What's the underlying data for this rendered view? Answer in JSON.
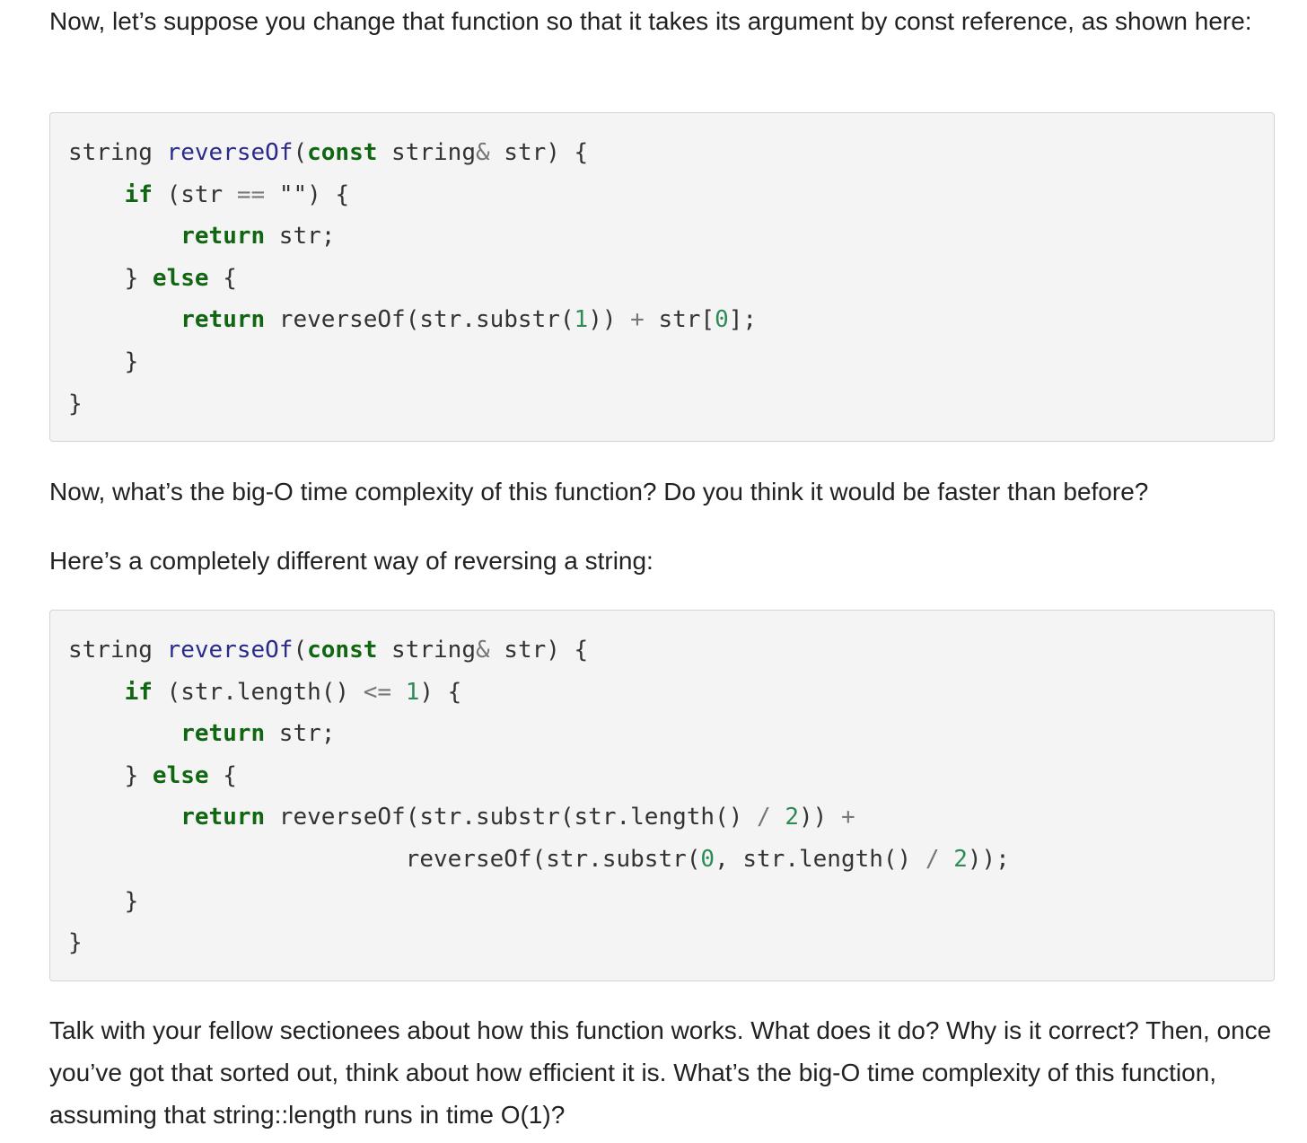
{
  "paragraphs": {
    "intro": "Now, let’s suppose you change that function so that it takes its argument by const reference, as shown here:",
    "question_bigo": "Now, what’s the big-O time complexity of this function? Do you think it would be faster than before?",
    "different_way": "Here’s a completely different way of reversing a string:",
    "discussion": "Talk with your fellow sectionees about how this function works. What does it do? Why is it correct? Then, once you’ve got that sorted out, think about how efficient it is. What’s the big-O time complexity of this function, assuming that string::length runs in time O(1)?"
  },
  "code_block_1": {
    "lines": [
      [
        {
          "t": "string ",
          "c": ""
        },
        {
          "t": "reverseOf",
          "c": "fn"
        },
        {
          "t": "(",
          "c": ""
        },
        {
          "t": "const",
          "c": "kw"
        },
        {
          "t": " string",
          "c": ""
        },
        {
          "t": "&",
          "c": "op"
        },
        {
          "t": " str) {",
          "c": ""
        }
      ],
      [
        {
          "t": "    ",
          "c": ""
        },
        {
          "t": "if",
          "c": "kw"
        },
        {
          "t": " (str ",
          "c": ""
        },
        {
          "t": "==",
          "c": "op"
        },
        {
          "t": " \"\") {",
          "c": ""
        }
      ],
      [
        {
          "t": "        ",
          "c": ""
        },
        {
          "t": "return",
          "c": "kw"
        },
        {
          "t": " str;",
          "c": ""
        }
      ],
      [
        {
          "t": "    } ",
          "c": ""
        },
        {
          "t": "else",
          "c": "kw"
        },
        {
          "t": " {",
          "c": ""
        }
      ],
      [
        {
          "t": "        ",
          "c": ""
        },
        {
          "t": "return",
          "c": "kw"
        },
        {
          "t": " reverseOf(str.substr(",
          "c": ""
        },
        {
          "t": "1",
          "c": "num"
        },
        {
          "t": ")) ",
          "c": ""
        },
        {
          "t": "+",
          "c": "op"
        },
        {
          "t": " str[",
          "c": ""
        },
        {
          "t": "0",
          "c": "num"
        },
        {
          "t": "];",
          "c": ""
        }
      ],
      [
        {
          "t": "    }",
          "c": ""
        }
      ],
      [
        {
          "t": "}",
          "c": ""
        }
      ]
    ]
  },
  "code_block_2": {
    "lines": [
      [
        {
          "t": "string ",
          "c": ""
        },
        {
          "t": "reverseOf",
          "c": "fn"
        },
        {
          "t": "(",
          "c": ""
        },
        {
          "t": "const",
          "c": "kw"
        },
        {
          "t": " string",
          "c": ""
        },
        {
          "t": "&",
          "c": "op"
        },
        {
          "t": " str) {",
          "c": ""
        }
      ],
      [
        {
          "t": "    ",
          "c": ""
        },
        {
          "t": "if",
          "c": "kw"
        },
        {
          "t": " (str.length() ",
          "c": ""
        },
        {
          "t": "<=",
          "c": "op"
        },
        {
          "t": " ",
          "c": ""
        },
        {
          "t": "1",
          "c": "num"
        },
        {
          "t": ") {",
          "c": ""
        }
      ],
      [
        {
          "t": "        ",
          "c": ""
        },
        {
          "t": "return",
          "c": "kw"
        },
        {
          "t": " str;",
          "c": ""
        }
      ],
      [
        {
          "t": "    } ",
          "c": ""
        },
        {
          "t": "else",
          "c": "kw"
        },
        {
          "t": " {",
          "c": ""
        }
      ],
      [
        {
          "t": "        ",
          "c": ""
        },
        {
          "t": "return",
          "c": "kw"
        },
        {
          "t": " reverseOf(str.substr(str.length() ",
          "c": ""
        },
        {
          "t": "/",
          "c": "op"
        },
        {
          "t": " ",
          "c": ""
        },
        {
          "t": "2",
          "c": "num"
        },
        {
          "t": ")) ",
          "c": ""
        },
        {
          "t": "+",
          "c": "op"
        }
      ],
      [
        {
          "t": "                ",
          "c": ""
        },
        {
          "t": "        reverseOf(str.substr(",
          "c": ""
        },
        {
          "t": "0",
          "c": "num"
        },
        {
          "t": ", str.length() ",
          "c": ""
        },
        {
          "t": "/",
          "c": "op"
        },
        {
          "t": " ",
          "c": ""
        },
        {
          "t": "2",
          "c": "num"
        },
        {
          "t": "));",
          "c": ""
        }
      ],
      [
        {
          "t": "    }",
          "c": ""
        }
      ],
      [
        {
          "t": "}",
          "c": ""
        }
      ]
    ]
  },
  "colors": {
    "keyword": "#116611",
    "function_name": "#2a2a8a",
    "number": "#2e8b57",
    "operator": "#777777",
    "code_background": "#f4f4f4",
    "text": "#222222"
  }
}
